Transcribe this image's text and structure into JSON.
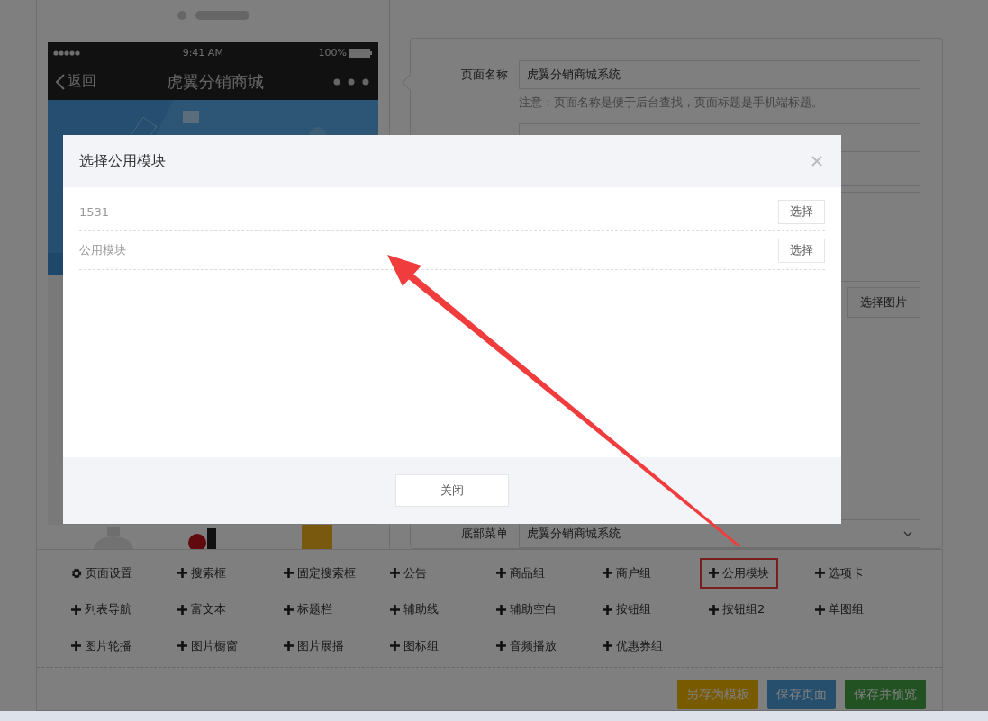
{
  "phone": {
    "status_time": "9:41 AM",
    "battery": "100%",
    "back_label": "返回",
    "title": "虎翼分销商城"
  },
  "form": {
    "page_name": {
      "label": "页面名称",
      "value": "虎翼分销商城系统"
    },
    "note": "注意：页面名称是便于后台查找，页面标题是手机端标题。",
    "choose_image_button": "选择图片",
    "bottom_menu": {
      "label": "底部菜单",
      "value": "虎翼分销商城系统"
    }
  },
  "toolbar": {
    "items": [
      {
        "label": "页面设置",
        "kind": "settings",
        "highlighted": false
      },
      {
        "label": "搜索框",
        "kind": "add",
        "highlighted": false
      },
      {
        "label": "固定搜索框",
        "kind": "add",
        "highlighted": false
      },
      {
        "label": "公告",
        "kind": "add",
        "highlighted": false
      },
      {
        "label": "商品组",
        "kind": "add",
        "highlighted": false
      },
      {
        "label": "商户组",
        "kind": "add",
        "highlighted": false
      },
      {
        "label": "公用模块",
        "kind": "add",
        "highlighted": true
      },
      {
        "label": "选项卡",
        "kind": "add",
        "highlighted": false
      },
      {
        "label": "列表导航",
        "kind": "add",
        "highlighted": false
      },
      {
        "label": "富文本",
        "kind": "add",
        "highlighted": false
      },
      {
        "label": "标题栏",
        "kind": "add",
        "highlighted": false
      },
      {
        "label": "辅助线",
        "kind": "add",
        "highlighted": false
      },
      {
        "label": "辅助空白",
        "kind": "add",
        "highlighted": false
      },
      {
        "label": "按钮组",
        "kind": "add",
        "highlighted": false
      },
      {
        "label": "按钮组2",
        "kind": "add",
        "highlighted": false
      },
      {
        "label": "单图组",
        "kind": "add",
        "highlighted": false
      },
      {
        "label": "图片轮播",
        "kind": "add",
        "highlighted": false
      },
      {
        "label": "图片橱窗",
        "kind": "add",
        "highlighted": false
      },
      {
        "label": "图片展播",
        "kind": "add",
        "highlighted": false
      },
      {
        "label": "图标组",
        "kind": "add",
        "highlighted": false
      },
      {
        "label": "音频播放",
        "kind": "add",
        "highlighted": false
      },
      {
        "label": "优惠券组",
        "kind": "add",
        "highlighted": false
      }
    ],
    "actions": [
      {
        "label": "另存为模板",
        "kind": "template"
      },
      {
        "label": "保存页面",
        "kind": "save"
      },
      {
        "label": "保存并预览",
        "kind": "preview"
      }
    ]
  },
  "modal": {
    "title": "选择公用模块",
    "rows": [
      {
        "name": "1531",
        "button": "选择"
      },
      {
        "name": "公用模块",
        "button": "选择"
      }
    ],
    "close_button": "关闭"
  }
}
